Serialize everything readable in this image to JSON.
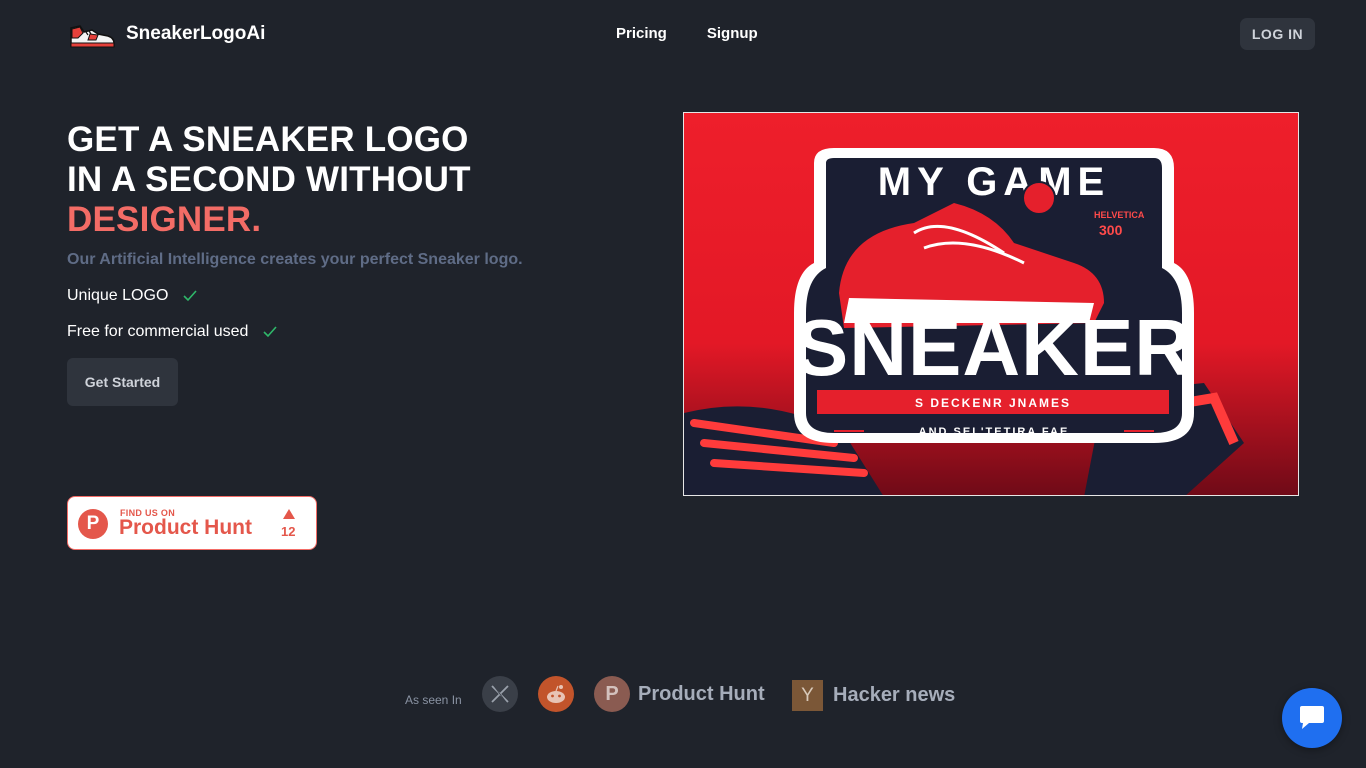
{
  "header": {
    "brand_name": "SneakerLogoAi",
    "nav": [
      {
        "label": "Pricing"
      },
      {
        "label": "Signup"
      }
    ],
    "login_label": "LOG IN"
  },
  "hero": {
    "title_line1": "GET A SNEAKER LOGO",
    "title_line2": "IN A SECOND WITHOUT",
    "title_accent": "DESIGNER.",
    "subtitle": "Our Artificial Intelligence creates your perfect Sneaker logo.",
    "features": [
      {
        "label": "Unique LOGO"
      },
      {
        "label": "Free for commercial used"
      }
    ],
    "cta_label": "Get Started",
    "accent_color": "#f36c66",
    "check_color": "#2fb86a"
  },
  "product_hunt_badge": {
    "find_us": "FIND US ON",
    "name": "Product Hunt",
    "icon_letter": "P",
    "upvotes": "12"
  },
  "hero_image": {
    "top_text": "MY GAME",
    "main_text": "SNEAKER",
    "small_right_1": "HELVETICA",
    "small_right_2": "300",
    "banner_text": "S DECKENR JNAMES",
    "bottom_text": "AND SEL'TETIRA FAE"
  },
  "as_seen_in": {
    "label": "As seen In",
    "items": [
      {
        "icon": "x-icon"
      },
      {
        "icon": "reddit-icon"
      },
      {
        "icon": "product-hunt-icon",
        "letter": "P",
        "label": "Product Hunt"
      },
      {
        "icon": "hacker-news-icon",
        "letter": "Y",
        "label": "Hacker news"
      }
    ]
  },
  "chat": {
    "icon": "chat-icon",
    "color": "#1f6ff0"
  }
}
